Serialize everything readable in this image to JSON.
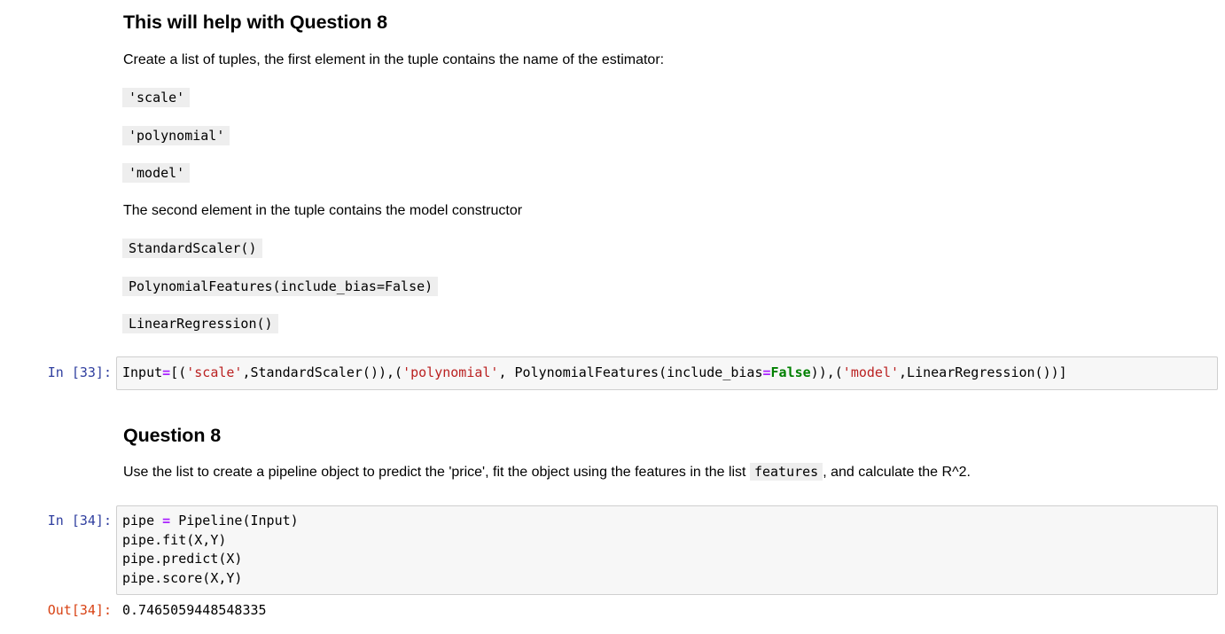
{
  "section1": {
    "heading": "This will help with Question 8",
    "intro": "Create a list of tuples, the first element in the tuple contains the name of the estimator:",
    "names": [
      "'scale'",
      "'polynomial'",
      "'model'"
    ],
    "second_text": "The second element in the tuple contains the model constructor",
    "constructors": [
      "StandardScaler()",
      "PolynomialFeatures(include_bias=False)",
      "LinearRegression()"
    ]
  },
  "cell33": {
    "prompt": "In [33]:",
    "code": {
      "t1": "Input",
      "t2": "=",
      "t3": "[(",
      "t4": "'scale'",
      "t5": ",StandardScaler()),(",
      "t6": "'polynomial'",
      "t7": ", PolynomialFeatures(include_bias",
      "t8": "=",
      "t9": "False",
      "t10": ")),(",
      "t11": "'model'",
      "t12": ",LinearRegression())]"
    }
  },
  "section2": {
    "heading": "Question 8",
    "text_before": "Use the list to create a pipeline object to predict the 'price', fit the object using the features in the list ",
    "code_word": "features",
    "text_after": ", and calculate the R^2."
  },
  "cell34": {
    "prompt": "In [34]:",
    "line1": {
      "a": "pipe ",
      "op": "=",
      "b": " Pipeline(Input)"
    },
    "line2": "pipe.fit(X,Y)",
    "line3": "pipe.predict(X)",
    "line4": "pipe.score(X,Y)",
    "out_prompt": "Out[34]:",
    "output": "0.7465059448548335"
  },
  "colors": {
    "prompt_in": "#303f9f",
    "prompt_out": "#d84315",
    "string": "#ba2121",
    "keyword": "#008000",
    "operator": "#aa22ff",
    "cell_bg": "#f7f7f7",
    "inline_code_bg": "#eeeeee"
  }
}
